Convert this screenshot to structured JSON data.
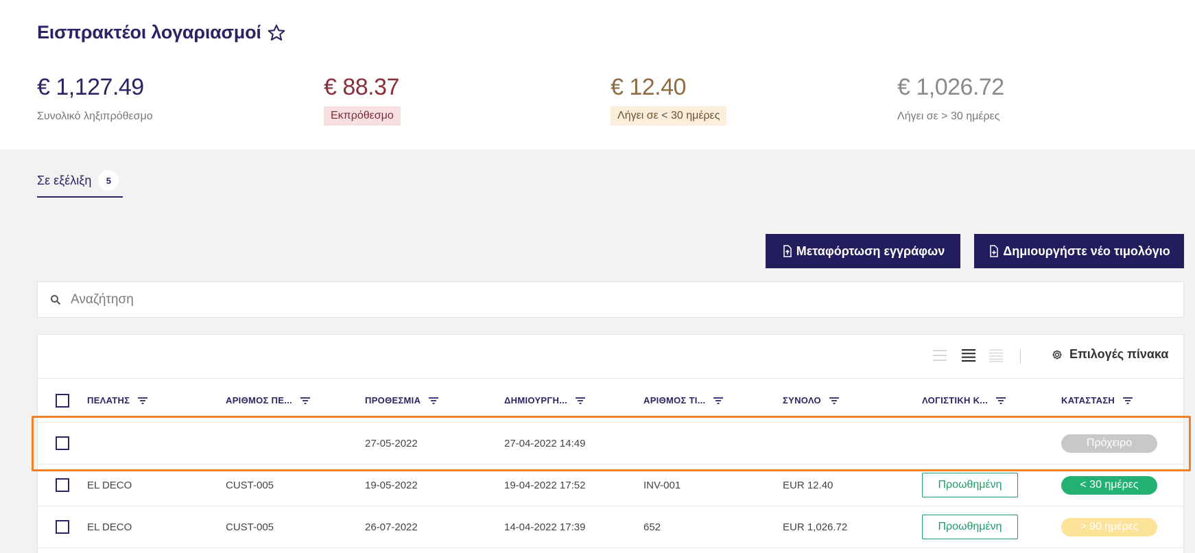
{
  "header": {
    "title": "Εισπρακτέοι λογαριασμοί",
    "favorite_icon": "star-outline-icon"
  },
  "kpis": [
    {
      "amount": "€ 1,127.49",
      "label": "Συνολικό ληξιπρόθεσμο",
      "color": "#2b2464"
    },
    {
      "amount": "€ 88.37",
      "label": "Εκπρόθεσμο",
      "color": "#8a2f3c"
    },
    {
      "amount": "€ 12.40",
      "label": "Λήγει σε < 30 ημέρες",
      "color": "#8f6c43"
    },
    {
      "amount": "€ 1,026.72",
      "label": "Λήγει σε > 30 ημέρες",
      "color": "#8a8a8a"
    }
  ],
  "tabs": [
    {
      "label": "Σε εξέλιξη",
      "count": "5"
    }
  ],
  "buttons": {
    "upload": "Μεταφόρτωση εγγράφων",
    "create_invoice": "Δημιουργήστε νέο τιμολόγιο"
  },
  "search": {
    "placeholder": "Αναζήτηση"
  },
  "table": {
    "options_label": "Επιλογές πίνακα",
    "columns": [
      "ΠΕΛΑΤΗΣ",
      "ΑΡΙΘΜΟΣ ΠΕ...",
      "ΠΡΟΘΕΣΜΙΑ",
      "ΔΗΜΙΟΥΡΓΗ...",
      "ΑΡΙΘΜΟΣ ΤΙ...",
      "ΣΥΝΟΛΟ",
      "ΛΟΓΙΣΤΙΚΗ Κ...",
      "ΚΑΤΑΣΤΑΣΗ"
    ],
    "rows": [
      {
        "customer": "",
        "customer_no": "",
        "due": "27-05-2022",
        "created": "27-04-2022 14:49",
        "invoice_no": "",
        "total": "",
        "accounting": "",
        "status": "Πρόχειρο",
        "status_color": "#c8c8c8"
      },
      {
        "customer": "EL DECO",
        "customer_no": "CUST-005",
        "due": "19-05-2022",
        "created": "19-04-2022 17:52",
        "invoice_no": "INV-001",
        "total": "EUR 12.40",
        "accounting": "Προωθημένη",
        "status": "< 30 ημέρες",
        "status_color": "#22b173"
      },
      {
        "customer": "EL DECO",
        "customer_no": "CUST-005",
        "due": "26-07-2022",
        "created": "14-04-2022 17:39",
        "invoice_no": "652",
        "total": "EUR 1,026.72",
        "accounting": "Προωθημένη",
        "status": "> 90 ημέρες",
        "status_color": "#fde29a"
      }
    ]
  },
  "colors": {
    "brand": "#231d5e",
    "highlight": "#f47f26",
    "accounting_green": "#1d9a67"
  }
}
